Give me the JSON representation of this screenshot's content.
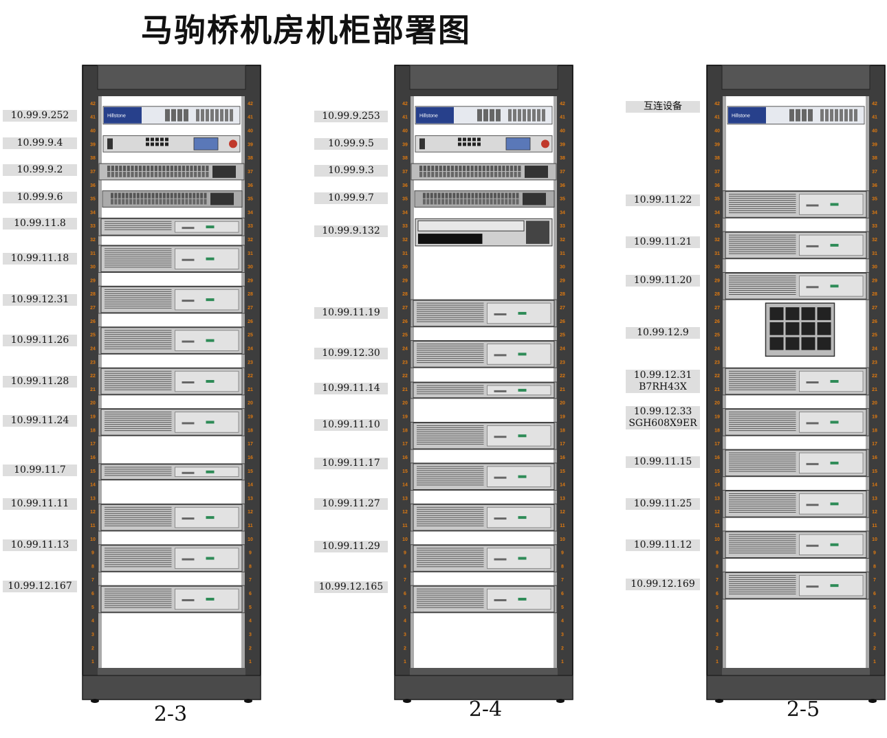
{
  "title": "马驹桥机房机柜部署图",
  "racks": [
    {
      "name": "2-3",
      "labels": [
        {
          "lines": [
            "10.99.9.252"
          ]
        },
        {
          "lines": [
            "10.99.9.4"
          ]
        },
        {
          "lines": [
            "10.99.9.2"
          ]
        },
        {
          "lines": [
            "10.99.9.6"
          ]
        },
        {
          "lines": [
            "10.99.11.8"
          ]
        },
        {
          "lines": [
            "10.99.11.18"
          ]
        },
        {
          "lines": [
            "10.99.12.31"
          ]
        },
        {
          "lines": [
            "10.99.11.26"
          ]
        },
        {
          "lines": [
            "10.99.11.28"
          ]
        },
        {
          "lines": [
            "10.99.11.24"
          ]
        },
        {
          "lines": [
            "10.99.11.7"
          ]
        },
        {
          "lines": [
            "10.99.11.11"
          ]
        },
        {
          "lines": [
            "10.99.11.13"
          ]
        },
        {
          "lines": [
            "10.99.12.167"
          ]
        }
      ]
    },
    {
      "name": "2-4",
      "labels": [
        {
          "lines": [
            "10.99.9.253"
          ]
        },
        {
          "lines": [
            "10.99.9.5"
          ]
        },
        {
          "lines": [
            "10.99.9.3"
          ]
        },
        {
          "lines": [
            "10.99.9.7"
          ]
        },
        {
          "lines": [
            "10.99.9.132"
          ]
        },
        {
          "lines": [
            "10.99.11.19"
          ]
        },
        {
          "lines": [
            "10.99.12.30"
          ]
        },
        {
          "lines": [
            "10.99.11.14"
          ]
        },
        {
          "lines": [
            "10.99.11.10"
          ]
        },
        {
          "lines": [
            "10.99.11.17"
          ]
        },
        {
          "lines": [
            "10.99.11.27"
          ]
        },
        {
          "lines": [
            "10.99.11.29"
          ]
        },
        {
          "lines": [
            "10.99.12.165"
          ]
        }
      ]
    },
    {
      "name": "2-5",
      "labels": [
        {
          "lines": [
            "互连设备"
          ]
        },
        {
          "lines": [
            "10.99.11.22"
          ]
        },
        {
          "lines": [
            "10.99.11.21"
          ]
        },
        {
          "lines": [
            "10.99.11.20"
          ]
        },
        {
          "lines": [
            "10.99.12.9"
          ]
        },
        {
          "lines": [
            "10.99.12.31",
            "B7RH43X"
          ]
        },
        {
          "lines": [
            "10.99.12.33",
            "SGH608X9ER"
          ]
        },
        {
          "lines": [
            "10.99.11.15"
          ]
        },
        {
          "lines": [
            "10.99.11.25"
          ]
        },
        {
          "lines": [
            "10.99.11.12"
          ]
        },
        {
          "lines": [
            "10.99.12.169"
          ]
        }
      ]
    }
  ],
  "device_logo_text": "Hillstone",
  "colors": {
    "rack_frame": "#3d3d3d",
    "rack_base": "#4a4a4a",
    "unit_number": "#e07a10",
    "label_bg": "#dedede",
    "server_body": "#c9c9c9",
    "led": "#2e8b57"
  }
}
